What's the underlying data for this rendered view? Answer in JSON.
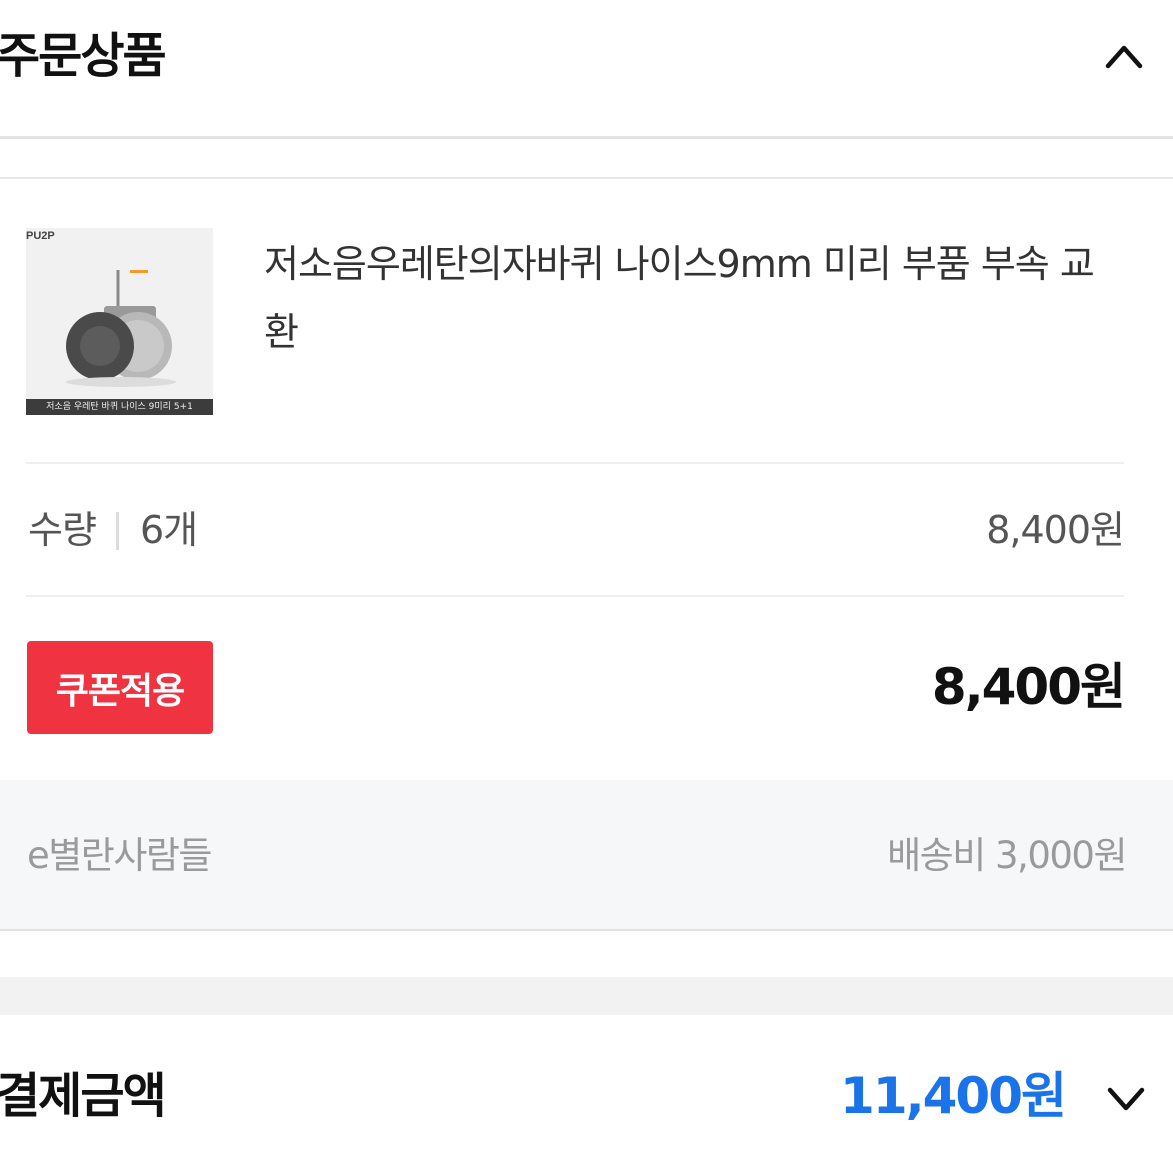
{
  "order_section": {
    "title": "주문상품",
    "toggle_icon": "chevron-up-icon"
  },
  "product": {
    "thumbnail": {
      "brand": "PU2P",
      "caption": "저소음 우레탄 바퀴 나이스 9미리 5+1"
    },
    "name": "저소음우레탄의자바퀴 나이스9mm 미리 부품 부속 교환",
    "quantity_label": "수량",
    "quantity_value": "6개",
    "unit_total": "8,400원"
  },
  "coupon": {
    "button_label": "쿠폰적용",
    "total": "8,400원"
  },
  "seller": {
    "name": "e별란사람들",
    "shipping_fee": "배송비 3,000원"
  },
  "payment": {
    "title": "결제금액",
    "amount": "11,400원",
    "toggle_icon": "chevron-down-icon"
  },
  "colors": {
    "coupon_button": "#ef3340",
    "payment_amount": "#1a73e8",
    "band_background": "#f6f7f8"
  }
}
